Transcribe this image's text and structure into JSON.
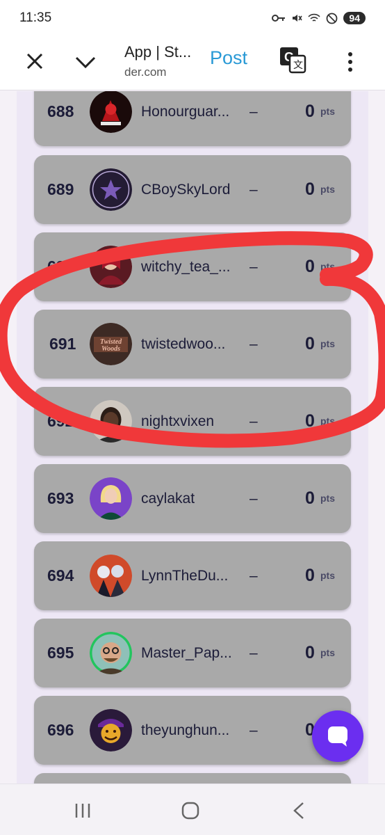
{
  "status_bar": {
    "time": "11:35",
    "battery": "94"
  },
  "toolbar": {
    "title": "App | St...",
    "url": "der.com",
    "post_label": "Post"
  },
  "leaderboard": {
    "rows": [
      {
        "rank": "688",
        "username": "Honourguar...",
        "dash": "–",
        "points": "0",
        "unit": "pts"
      },
      {
        "rank": "689",
        "username": "CBoySkyLord",
        "dash": "–",
        "points": "0",
        "unit": "pts"
      },
      {
        "rank": "690",
        "username": "witchy_tea_...",
        "dash": "–",
        "points": "0",
        "unit": "pts"
      },
      {
        "rank": "691",
        "username": "twistedwoo...",
        "dash": "–",
        "points": "0",
        "unit": "pts"
      },
      {
        "rank": "692",
        "username": "nightxvixen",
        "dash": "–",
        "points": "0",
        "unit": "pts"
      },
      {
        "rank": "693",
        "username": "caylakat",
        "dash": "–",
        "points": "0",
        "unit": "pts"
      },
      {
        "rank": "694",
        "username": "LynnTheDu...",
        "dash": "–",
        "points": "0",
        "unit": "pts"
      },
      {
        "rank": "695",
        "username": "Master_Pap...",
        "dash": "–",
        "points": "0",
        "unit": "pts"
      },
      {
        "rank": "696",
        "username": "theyunghun...",
        "dash": "–",
        "points": "0",
        "unit": "pts"
      }
    ]
  },
  "colors": {
    "row_bg": "#a9a9a9",
    "accent": "#2a9ad6",
    "fab": "#6b2ef0",
    "highlight": "#f0383a"
  },
  "icons": [
    "close-icon",
    "chevron-down-icon",
    "translate-icon",
    "more-vert-icon",
    "chat-icon",
    "recents-icon",
    "home-icon",
    "back-icon"
  ]
}
